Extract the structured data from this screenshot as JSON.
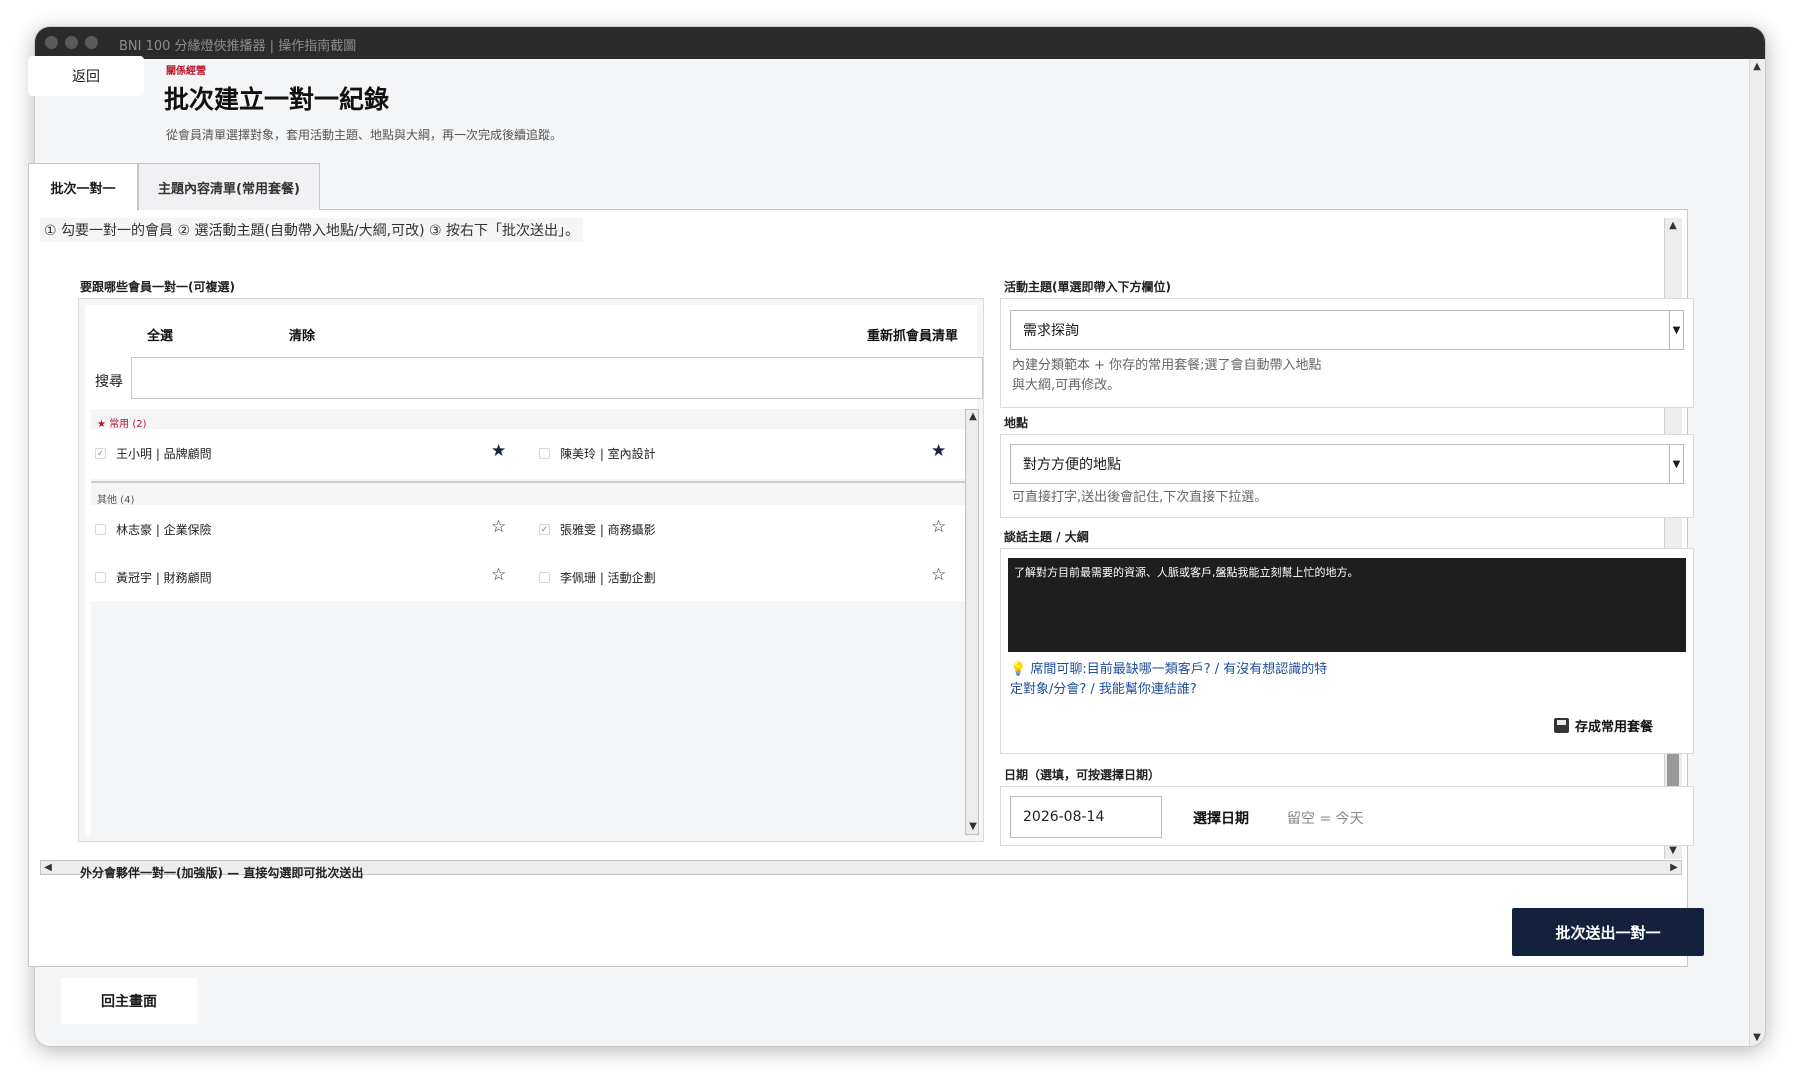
{
  "window": {
    "title": "BNI 100 分緣燈俠推播器 | 操作指南截圖"
  },
  "header": {
    "back_label": "返回",
    "eyebrow": "關係經營",
    "title": "批次建立一對一紀錄",
    "subtitle": "從會員清單選擇對象，套用活動主題、地點與大綱，再一次完成後續追蹤。"
  },
  "tabs": [
    {
      "label": "批次一對一"
    },
    {
      "label": "主題內容清單(常用套餐)"
    }
  ],
  "instructions": "① 勾要一對一的會員 ② 選活動主題(自動帶入地點/大綱,可改) ③ 按右下「批次送出」。",
  "members": {
    "section_label": "要跟哪些會員一對一(可複選)",
    "select_all": "全選",
    "clear": "清除",
    "refresh": "重新抓會員清單",
    "search_label": "搜尋",
    "search_value": "",
    "favorites_label": "★ 常用 (2)",
    "others_label": "其他 (4)",
    "favorites": [
      {
        "name": "王小明 | 品牌顧問",
        "checked": true,
        "starred": true
      },
      {
        "name": "陳美玲 | 室內設計",
        "checked": false,
        "starred": true
      }
    ],
    "others": [
      {
        "name": "林志豪 | 企業保險",
        "checked": false,
        "starred": false
      },
      {
        "name": "張雅雯 | 商務攝影",
        "checked": true,
        "starred": false
      },
      {
        "name": "黃冠宇 | 財務顧問",
        "checked": false,
        "starred": false
      },
      {
        "name": "李佩珊 | 活動企劃",
        "checked": false,
        "starred": false
      }
    ],
    "check_glyph": "✓",
    "star_filled": "★",
    "star_empty": "☆"
  },
  "topic": {
    "label": "活動主題(單選即帶入下方欄位)",
    "value": "需求探詢",
    "hint": "內建分類範本 + 你存的常用套餐;選了會自動帶入地點與大綱,可再修改。"
  },
  "location": {
    "label": "地點",
    "value": "對方方便的地點",
    "hint": "可直接打字,送出後會記住,下次直接下拉選。"
  },
  "outline": {
    "label": "談話主題 / 大綱",
    "value": "了解對方目前最需要的資源、人脈或客戶,盤點我能立刻幫上忙的地方。",
    "tip": "💡 席間可聊:目前最缺哪一類客戶? / 有沒有想認識的特定對象/分會? / 我能幫你連結誰?",
    "save_label": "存成常用套餐"
  },
  "date": {
    "label": "日期（選填，可按選擇日期）",
    "value": "2026-08-14",
    "pick_label": "選擇日期",
    "empty_note": "留空 = 今天"
  },
  "outer_partners_label": "外分會夥伴一對一(加強版) — 直接勾選即可批次送出",
  "submit_label": "批次送出一對一",
  "home_label": "回主畫面",
  "colors": {
    "accent": "#14213d",
    "eyebrow": "#b8152a",
    "tip": "#1f4e9a"
  }
}
